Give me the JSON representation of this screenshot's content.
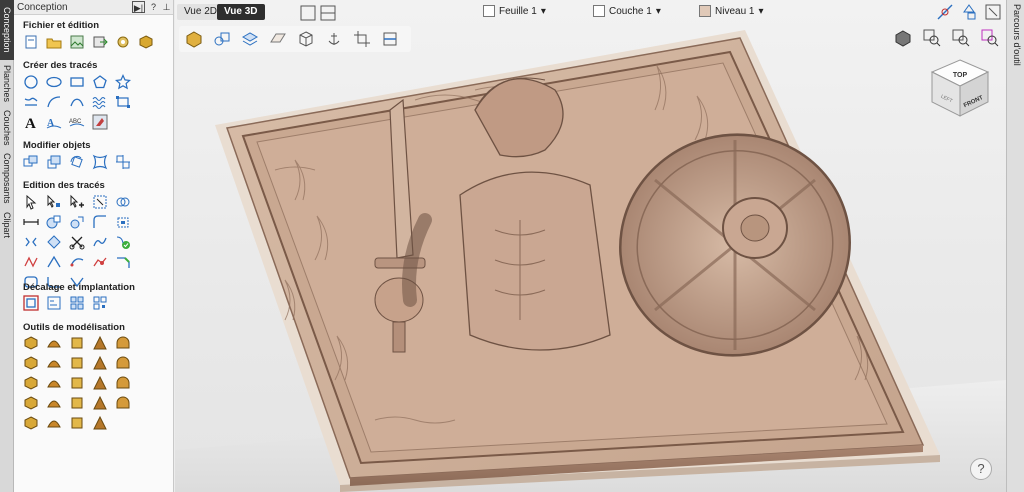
{
  "left_tabs": [
    "Conception",
    "Planches",
    "Couches",
    "Composants",
    "Clipart"
  ],
  "panel": {
    "title": "Conception",
    "pin_label": "▶|",
    "help_label": "?",
    "close_label": "ᵖ",
    "sections": [
      {
        "title": "Fichier et édition",
        "icons": [
          "new-file-icon",
          "crop-icon",
          "open-file-icon",
          "import-image-icon",
          "export-icon",
          "settings-gem-icon",
          "gold-cube-icon"
        ]
      },
      {
        "title": "Créer des tracés",
        "icons": [
          "circle-icon",
          "ellipse-icon",
          "rectangle-icon",
          "polygon-icon",
          "star-icon",
          "line-icon",
          "arc-icon",
          "curve-icon",
          "wave-icon",
          "dimension-icon",
          "text-icon",
          "text-on-path-icon",
          "text-art-icon",
          "image-trace-icon"
        ]
      },
      {
        "title": "Modifier objets",
        "icons": [
          "move-icon",
          "scale-icon",
          "rotate-icon",
          "distort-icon",
          "align-icon"
        ]
      },
      {
        "title": "Edition des tracés",
        "icons": [
          "select-node-icon",
          "node-edit-icon",
          "add-node-icon",
          "transform-icon",
          "weld-icon",
          "measure-icon",
          "trim-icon",
          "join-icon",
          "fillet-icon",
          "offset-icon",
          "mirror-icon",
          "close-vector-icon",
          "cut-icon",
          "spline-icon",
          "smooth-icon",
          "array-icon",
          "validate-icon",
          "fit-curve-icon",
          "bezier-icon",
          "chamfer-icon",
          "rounded-rect-icon",
          "join-curve-icon",
          "polyline-icon"
        ]
      },
      {
        "title": "Décalage et implantation",
        "icons": [
          "offset-vector-icon",
          "nesting-icon",
          "array-copy-icon",
          "qr-code-icon"
        ]
      },
      {
        "title": "Outils de modélisation",
        "icons": [
          "shape-editor-icon",
          "dome-icon",
          "extrude-icon",
          "weave-icon",
          "texture-icon",
          "component-icon",
          "bevel-icon",
          "sculpt-icon",
          "mold-icon",
          "lathe-icon",
          "cylinder-icon",
          "slice-icon",
          "merge-icon",
          "fade-icon",
          "tilt-icon",
          "spin-icon",
          "smooth-relief-icon",
          "noise-icon",
          "chamfer-relief-icon",
          "flatten-icon",
          "erase-icon",
          "dish-icon",
          "distort-relief-icon",
          "colorize-icon"
        ]
      }
    ]
  },
  "viewport": {
    "view2d_label": "Vue 2D",
    "view3d_label": "Vue 3D",
    "sheet_label": "Feuille 1",
    "layer_label": "Couche 1",
    "level_label": "Niveau 1",
    "cube_top": "TOP",
    "cube_front": "FRONT",
    "cube_left": "LEFT",
    "help_label": "?"
  },
  "right_tab_label": "Parcours d'outil",
  "colors": {
    "relief_light": "#d4b8a4",
    "relief_mid": "#b8957e",
    "relief_dark": "#6e5243",
    "panel_bg": "#fafafa",
    "active_tab": "#3c3c3c"
  }
}
